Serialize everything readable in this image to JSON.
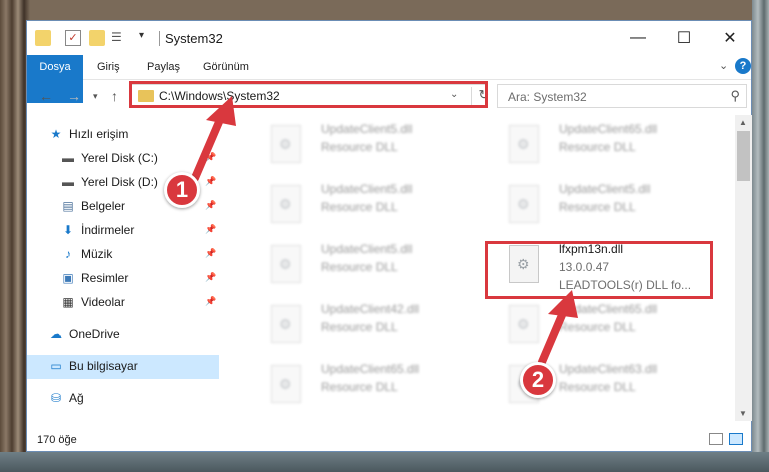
{
  "window": {
    "title": "System32",
    "controls": {
      "minimize": "—",
      "maximize": "☐",
      "close": "✕"
    }
  },
  "ribbon": {
    "tabs": [
      "Dosya",
      "Giriş",
      "Paylaş",
      "Görünüm"
    ],
    "help": "?"
  },
  "nav": {
    "address": "C:\\Windows\\System32",
    "search_placeholder": "Ara: System32"
  },
  "sidebar": {
    "items": [
      {
        "label": "Hızlı erişim",
        "icon": "star-icon",
        "glyph": "★",
        "color": "#1979ca",
        "pinned": false
      },
      {
        "label": "Yerel Disk (C:)",
        "icon": "drive-icon",
        "glyph": "▬",
        "color": "#555555",
        "pinned": true
      },
      {
        "label": "Yerel Disk (D:)",
        "icon": "drive-icon",
        "glyph": "▬",
        "color": "#555555",
        "pinned": true
      },
      {
        "label": "Belgeler",
        "icon": "documents-icon",
        "glyph": "▤",
        "color": "#4a6f99",
        "pinned": true
      },
      {
        "label": "İndirmeler",
        "icon": "download-icon",
        "glyph": "⬇",
        "color": "#1979ca",
        "pinned": true
      },
      {
        "label": "Müzik",
        "icon": "music-icon",
        "glyph": "♪",
        "color": "#1979ca",
        "pinned": true
      },
      {
        "label": "Resimler",
        "icon": "pictures-icon",
        "glyph": "▣",
        "color": "#3d7ab8",
        "pinned": true
      },
      {
        "label": "Videolar",
        "icon": "video-icon",
        "glyph": "▦",
        "color": "#333333",
        "pinned": true
      },
      {
        "label": "OneDrive",
        "icon": "cloud-icon",
        "glyph": "☁",
        "color": "#1979ca",
        "pinned": false
      },
      {
        "label": "Bu bilgisayar",
        "icon": "computer-icon",
        "glyph": "▭",
        "color": "#1979ca",
        "pinned": false
      },
      {
        "label": "Ağ",
        "icon": "network-icon",
        "glyph": "⛁",
        "color": "#1979ca",
        "pinned": false
      }
    ]
  },
  "files": [
    {
      "name": "UpdateClient5.dll",
      "sub": "Resource DLL",
      "focus": false
    },
    {
      "name": "UpdateClient65.dll",
      "sub": "Resource DLL",
      "focus": false
    },
    {
      "name": "UpdateClient5.dll",
      "sub": "Resource DLL",
      "focus": false
    },
    {
      "name": "UpdateClient5.dll",
      "sub": "Resource DLL",
      "focus": false
    },
    {
      "name": "UpdateClient5.dll",
      "sub": "Resource DLL",
      "focus": false
    },
    {
      "name": "lfxpm13n.dll",
      "sub": "13.0.0.47",
      "sub2": "LEADTOOLS(r) DLL fo...",
      "focus": true
    },
    {
      "name": "UpdateClient42.dll",
      "sub": "Resource DLL",
      "focus": false
    },
    {
      "name": "UpdateClient65.dll",
      "sub": "Resource DLL",
      "focus": false
    },
    {
      "name": "UpdateClient65.dll",
      "sub": "Resource DLL",
      "focus": false
    },
    {
      "name": "UpdateClient63.dll",
      "sub": "Resource DLL",
      "focus": false
    }
  ],
  "status": {
    "count": "170 öğe"
  },
  "annotations": {
    "step1": "1",
    "step2": "2",
    "color": "#d9383e"
  }
}
